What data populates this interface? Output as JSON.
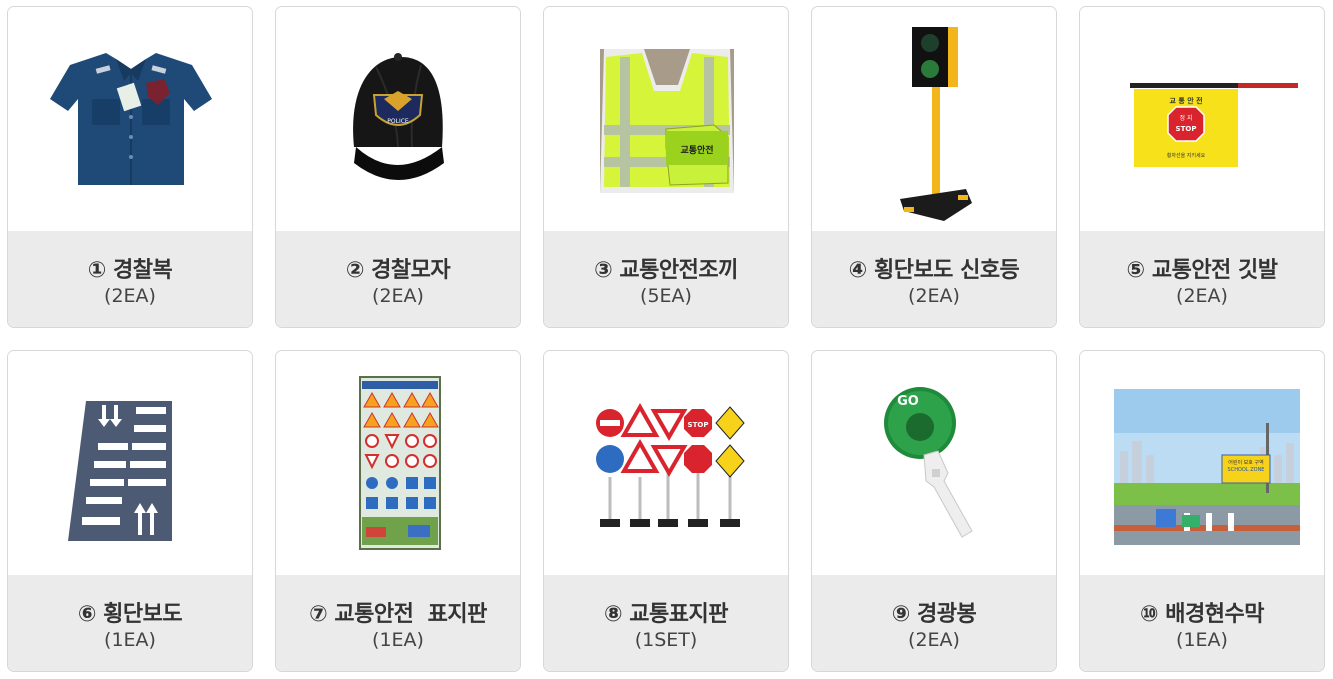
{
  "items": [
    {
      "name": "① 경찰복",
      "qty": "(2EA)",
      "image": "police-uniform-image"
    },
    {
      "name": "② 경찰모자",
      "qty": "(2EA)",
      "image": "police-cap-image"
    },
    {
      "name": "③ 교통안전조끼",
      "qty": "(5EA)",
      "image": "safety-vest-image"
    },
    {
      "name": "④ 횡단보도 신호등",
      "qty": "(2EA)",
      "image": "crosswalk-traffic-light-image"
    },
    {
      "name": "⑤ 교통안전 깃발",
      "qty": "(2EA)",
      "image": "traffic-safety-flag-image"
    },
    {
      "name": "⑥ 횡단보도",
      "qty": "(1EA)",
      "image": "crosswalk-mat-image"
    },
    {
      "name": "⑦ 교통안전  표지판",
      "qty": "(1EA)",
      "image": "traffic-safety-sign-board-image"
    },
    {
      "name": "⑧ 교통표지판",
      "qty": "(1SET)",
      "image": "traffic-signs-set-image"
    },
    {
      "name": "⑨ 경광봉",
      "qty": "(2EA)",
      "image": "go-paddle-image"
    },
    {
      "name": "⑩ 배경현수막",
      "qty": "(1EA)",
      "image": "background-banner-image"
    }
  ],
  "image_text": {
    "vest_badge": "교통안전",
    "flag_title": "교 통 안 전",
    "flag_stop_top": "정 지",
    "flag_stop": "STOP",
    "flag_footer": "횡자선을 지키세요",
    "cap_badge": "POLICE",
    "paddle": "GO",
    "sign_stop": "STOP",
    "banner_title": "어린이 보호 구역",
    "banner_sub": "SCHOOL ZONE"
  },
  "colors": {
    "card_border": "#d7d7d7",
    "caption_bg": "#ebebeb",
    "caption_text": "#333333",
    "uniform": "#1f4a78",
    "vest": "#d6f53a",
    "signal_pole": "#f2b51c",
    "flag": "#f7e11a",
    "stop_red": "#d9232d",
    "paddle_green": "#1f8a3a"
  }
}
